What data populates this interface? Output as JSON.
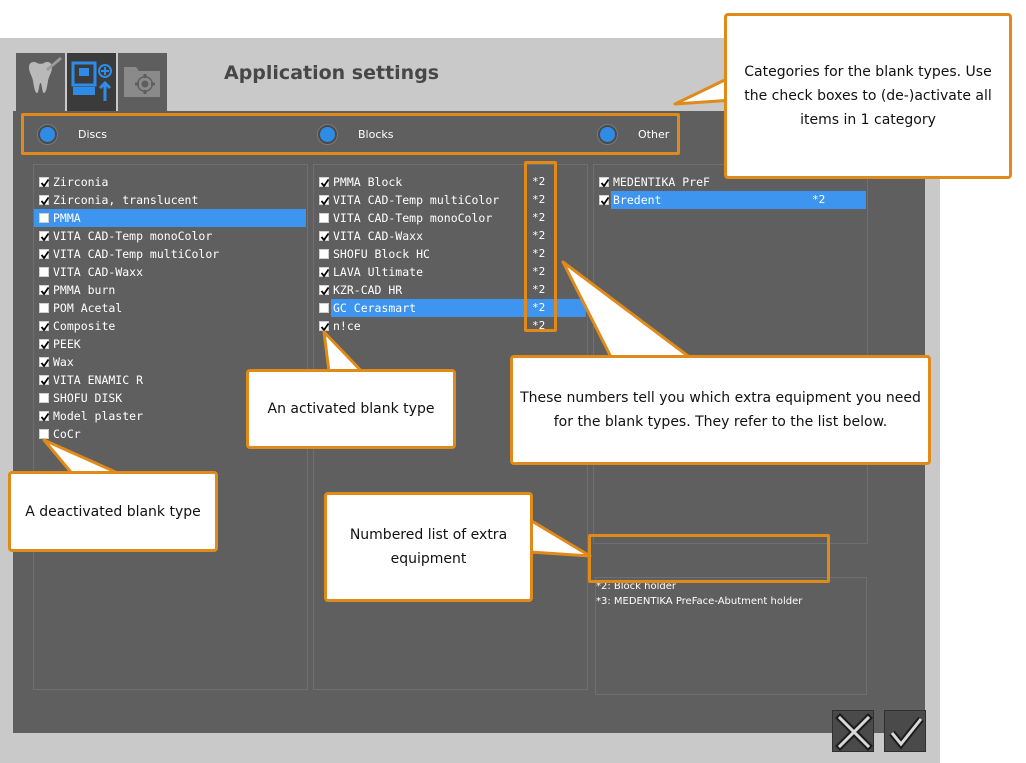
{
  "app": {
    "title": "Application settings"
  },
  "tabs": [
    {
      "icon": "tooth-icon"
    },
    {
      "icon": "blank-upload-icon"
    },
    {
      "icon": "folder-gear-icon"
    }
  ],
  "categories": [
    {
      "label": "Discs"
    },
    {
      "label": "Blocks"
    },
    {
      "label": "Other"
    }
  ],
  "discs": [
    {
      "label": "Zirconia",
      "checked": true
    },
    {
      "label": "Zirconia, translucent",
      "checked": true
    },
    {
      "label": "PMMA",
      "checked": false,
      "selected": true
    },
    {
      "label": "VITA CAD-Temp monoColor",
      "checked": true
    },
    {
      "label": "VITA CAD-Temp multiColor",
      "checked": true
    },
    {
      "label": "VITA CAD-Waxx",
      "checked": false
    },
    {
      "label": "PMMA burn",
      "checked": true
    },
    {
      "label": "POM Acetal",
      "checked": false
    },
    {
      "label": "Composite",
      "checked": true
    },
    {
      "label": "PEEK",
      "checked": true
    },
    {
      "label": "Wax",
      "checked": true
    },
    {
      "label": "VITA ENAMIC R",
      "checked": true
    },
    {
      "label": "SHOFU DISK",
      "checked": false
    },
    {
      "label": "Model plaster",
      "checked": true
    },
    {
      "label": "CoCr",
      "checked": false
    }
  ],
  "blocks": [
    {
      "label": "PMMA Block",
      "checked": true,
      "note": "*2"
    },
    {
      "label": "VITA CAD-Temp multiColor",
      "checked": true,
      "note": "*2"
    },
    {
      "label": "VITA CAD-Temp monoColor",
      "checked": false,
      "note": "*2"
    },
    {
      "label": "VITA CAD-Waxx",
      "checked": true,
      "note": "*2"
    },
    {
      "label": "SHOFU Block HC",
      "checked": false,
      "note": "*2"
    },
    {
      "label": "LAVA Ultimate",
      "checked": true,
      "note": "*2"
    },
    {
      "label": "KZR-CAD HR",
      "checked": true,
      "note": "*2"
    },
    {
      "label": "GC Cerasmart",
      "checked": false,
      "note": "*2",
      "selected": true
    },
    {
      "label": "n!ce",
      "checked": true,
      "note": "*2"
    }
  ],
  "other": [
    {
      "label": "MEDENTIKA PreF",
      "checked": true,
      "note": ""
    },
    {
      "label": "Bredent",
      "checked": true,
      "note": "*2",
      "selected": true
    }
  ],
  "footnotes": [
    "*2: Block holder",
    "*3: MEDENTIKA PreFace-Abutment holder"
  ],
  "buttons": {
    "cancel_icon": "close-icon",
    "ok_icon": "checkmark-icon"
  },
  "callouts": {
    "categories": "Categories for the blank types. Use the check boxes to (de-)activate all items in 1 category",
    "activated": "An activated blank type",
    "deactivated": "A deactivated blank type",
    "numbers": "These numbers tell you which extra equipment you need for the blank types. They refer to the list below.",
    "list": "Numbered list of extra equipment"
  },
  "colors": {
    "accent": "#3d95f0",
    "callout_border": "#e08a1a",
    "panel": "#5f5f5f",
    "window": "#c9c9c9"
  }
}
